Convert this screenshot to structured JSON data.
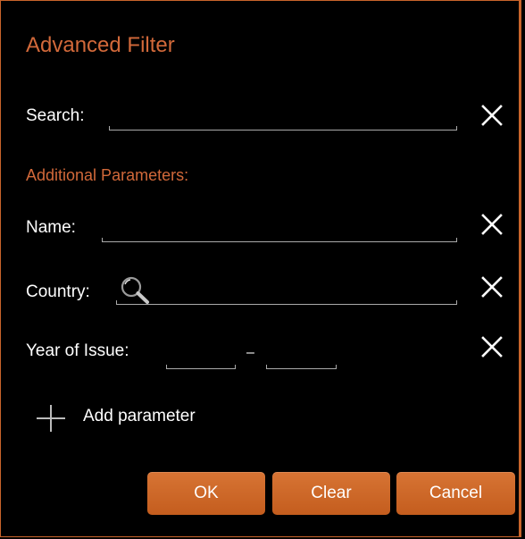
{
  "dialog": {
    "title": "Advanced Filter",
    "search": {
      "label": "Search:",
      "value": ""
    },
    "section_title": "Additional Parameters:",
    "name": {
      "label": "Name:",
      "value": ""
    },
    "country": {
      "label": "Country:",
      "value": ""
    },
    "year": {
      "label": "Year of Issue:",
      "separator": "–",
      "from": "",
      "to": ""
    },
    "add_parameter": "Add parameter",
    "buttons": {
      "ok": "OK",
      "clear": "Clear",
      "cancel": "Cancel"
    }
  },
  "colors": {
    "accent": "#d2693a",
    "button": "#cf6a2b",
    "background": "#000000",
    "text": "#ffffff",
    "field_line": "#aaaaaa"
  },
  "icons": [
    "close-icon",
    "search-icon",
    "plus-icon"
  ]
}
